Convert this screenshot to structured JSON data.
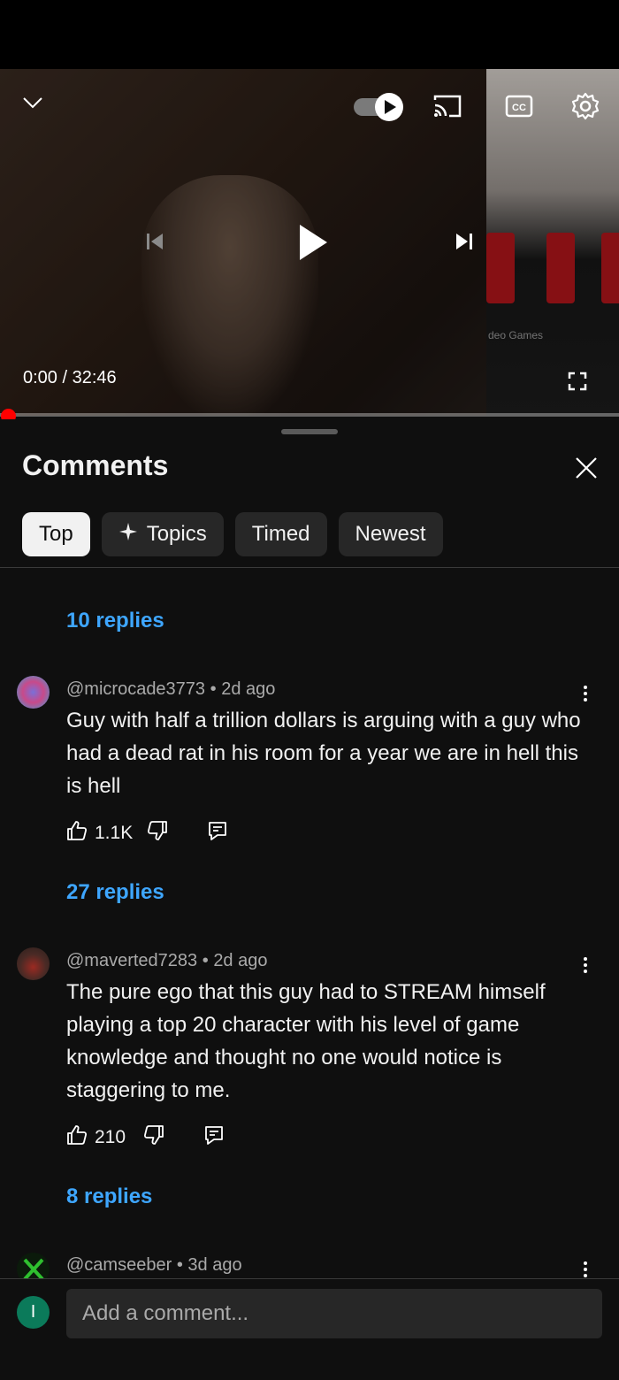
{
  "player": {
    "current_time": "0:00",
    "separator": "/",
    "duration": "32:46",
    "side_text": "deo Games",
    "progress": 0.0
  },
  "comments": {
    "title": "Comments",
    "filters": [
      {
        "label": "Top",
        "active": true
      },
      {
        "label": "Topics",
        "active": false,
        "icon": "sparkle-icon"
      },
      {
        "label": "Timed",
        "active": false
      },
      {
        "label": "Newest",
        "active": false
      }
    ],
    "first_replies": "10 replies",
    "items": [
      {
        "author": "@microcade3773",
        "age": "2d ago",
        "text": "Guy with half a trillion dollars is arguing with a guy who had a dead rat in his room for a year we are in hell this is hell",
        "likes": "1.1K",
        "replies": "27 replies"
      },
      {
        "author": "@maverted7283",
        "age": "2d ago",
        "text": "The pure ego that this guy had to STREAM himself playing a top 20 character with his level of game knowledge and thought no one would notice is staggering to me.",
        "likes": "210",
        "replies": "8 replies"
      },
      {
        "author": "@camseeber",
        "age": "3d ago"
      }
    ]
  },
  "composer": {
    "user_initial": "I",
    "placeholder": "Add a comment..."
  },
  "colors": {
    "accent_link": "#3ea6ff",
    "progress": "#ff0000",
    "background": "#0f0f0f",
    "chip": "#272727"
  }
}
